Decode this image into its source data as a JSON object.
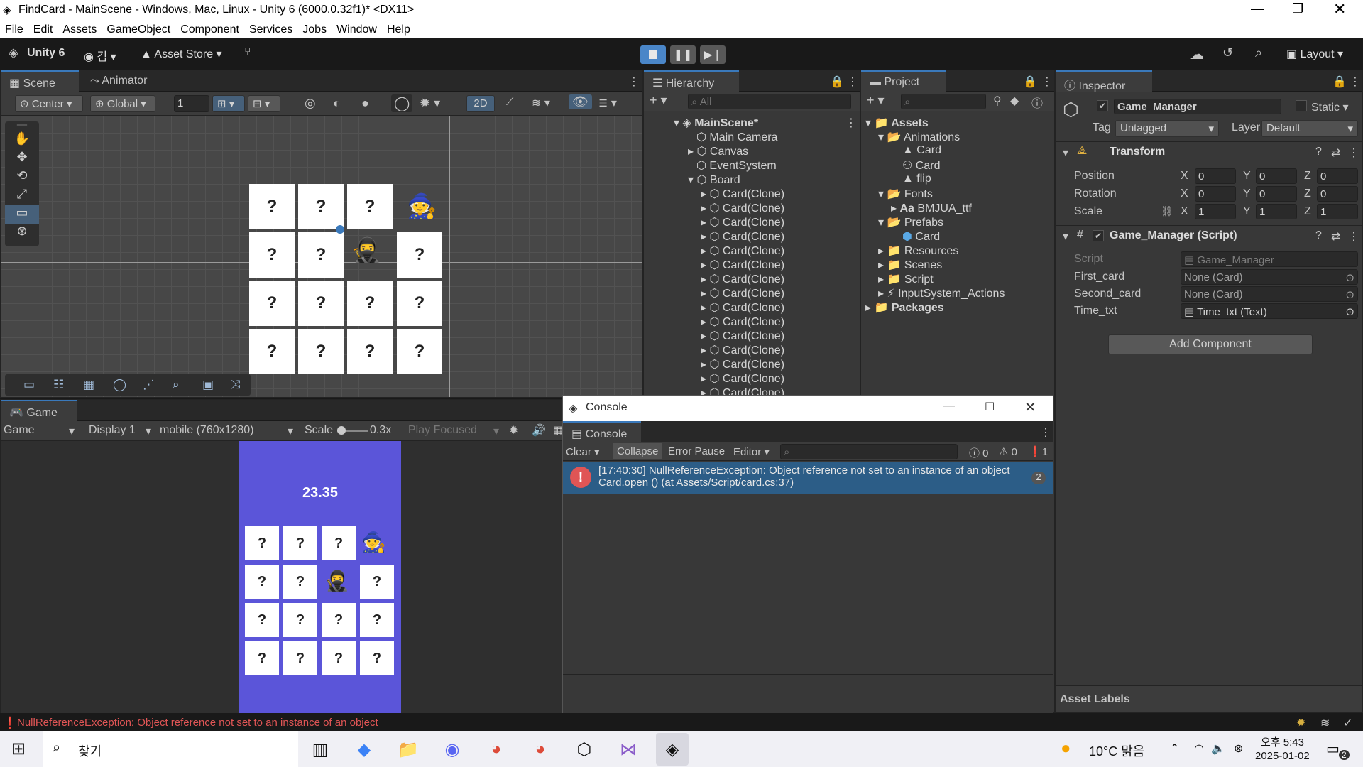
{
  "window": {
    "title": "FindCard - MainScene - Windows, Mac, Linux - Unity 6 (6000.0.32f1)* <DX11>"
  },
  "menu": [
    "File",
    "Edit",
    "Assets",
    "GameObject",
    "Component",
    "Services",
    "Jobs",
    "Window",
    "Help"
  ],
  "toolbar": {
    "unity_label": "Unity 6",
    "account": "김",
    "asset_store": "Asset Store",
    "layout": "Layout"
  },
  "scene": {
    "tab_scene": "Scene",
    "tab_animator": "Animator",
    "pivot": "Center",
    "space": "Global",
    "snap_value": "1",
    "mode_2d": "2D"
  },
  "game": {
    "tab": "Game",
    "view_mode": "Game",
    "display": "Display 1",
    "resolution": "mobile (760x1280)",
    "scale_label": "Scale",
    "scale_value": "0.3x",
    "play_focused": "Play Focused",
    "timer": "23.35",
    "card_symbol": "?"
  },
  "hierarchy": {
    "tab": "Hierarchy",
    "search_placeholder": "All",
    "scene_name": "MainScene*",
    "items": [
      "Main Camera",
      "Canvas",
      "EventSystem",
      "Board"
    ],
    "clones": [
      "Card(Clone)",
      "Card(Clone)",
      "Card(Clone)",
      "Card(Clone)",
      "Card(Clone)",
      "Card(Clone)",
      "Card(Clone)",
      "Card(Clone)",
      "Card(Clone)",
      "Card(Clone)",
      "Card(Clone)",
      "Card(Clone)",
      "Card(Clone)",
      "Card(Clone)",
      "Card(Clone)"
    ]
  },
  "project": {
    "tab": "Project",
    "assets": "Assets",
    "animations": "Animations",
    "anim_card1": "Card",
    "anim_card2": "Card",
    "anim_flip": "flip",
    "fonts": "Fonts",
    "font_prefix": "Aa",
    "font_file": "BMJUA_ttf",
    "prefabs": "Prefabs",
    "prefab_card": "Card",
    "resources": "Resources",
    "scenes": "Scenes",
    "script": "Script",
    "input_actions": "InputSystem_Actions",
    "packages": "Packages"
  },
  "inspector": {
    "tab": "Inspector",
    "object_name": "Game_Manager",
    "static": "Static",
    "tag_label": "Tag",
    "tag_value": "Untagged",
    "layer_label": "Layer",
    "layer_value": "Default",
    "transform": "Transform",
    "position": "Position",
    "rotation": "Rotation",
    "scale": "Scale",
    "axes": [
      "X",
      "Y",
      "Z"
    ],
    "pos": [
      "0",
      "0",
      "0"
    ],
    "rot": [
      "0",
      "0",
      "0"
    ],
    "scl": [
      "1",
      "1",
      "1"
    ],
    "component": "Game_Manager (Script)",
    "script_label": "Script",
    "script_value": "Game_Manager",
    "first_card_label": "First_card",
    "first_card_value": "None (Card)",
    "second_card_label": "Second_card",
    "second_card_value": "None (Card)",
    "time_label": "Time_txt",
    "time_value": "Time_txt (Text)",
    "add_component": "Add Component",
    "asset_labels": "Asset Labels"
  },
  "console": {
    "window_title": "Console",
    "tab": "Console",
    "clear": "Clear",
    "collapse": "Collapse",
    "error_pause": "Error Pause",
    "editor": "Editor",
    "count_info": "0",
    "count_warn": "0",
    "count_error": "1",
    "message_line1": "[17:40:30] NullReferenceException: Object reference not set to an instance of an object",
    "message_line2": "Card.open () (at Assets/Script/card.cs:37)",
    "message_count": "2"
  },
  "statusbar": {
    "message": "NullReferenceException: Object reference not set to an instance of an object"
  },
  "taskbar": {
    "search": "찾기",
    "weather": "10°C 맑음",
    "time": "오후 5:43",
    "date": "2025-01-02",
    "notif": "2"
  },
  "colors": {
    "accent": "#3a79bb",
    "game_bg": "#5b55d9",
    "error": "#e05555",
    "selection": "#2c5d87"
  }
}
